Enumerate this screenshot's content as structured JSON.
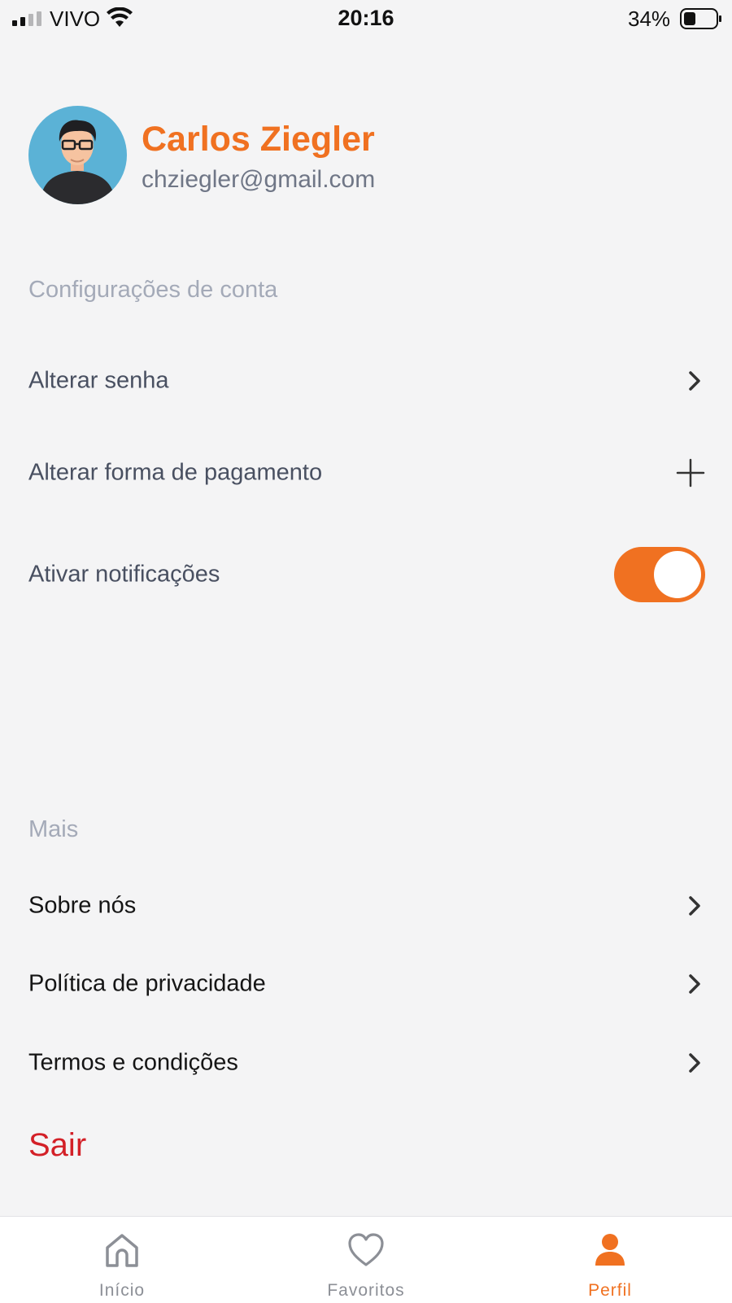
{
  "status_bar": {
    "carrier": "VIVO",
    "time": "20:16",
    "battery": "34%"
  },
  "profile": {
    "name": "Carlos Ziegler",
    "email": "chziegler@gmail.com"
  },
  "account_settings": {
    "title": "Configurações de conta",
    "change_password": "Alterar senha",
    "change_payment": "Alterar forma de pagamento",
    "notifications": "Ativar notificações",
    "notifications_enabled": true
  },
  "more": {
    "title": "Mais",
    "about": "Sobre nós",
    "privacy": "Política de privacidade",
    "terms": "Termos e condições"
  },
  "logout_label": "Sair",
  "tab_bar": {
    "home": "Início",
    "favorites": "Favoritos",
    "profile": "Perfil",
    "active": "profile"
  },
  "colors": {
    "accent": "#f07121",
    "logout": "#d32027",
    "background": "#f4f4f5"
  }
}
